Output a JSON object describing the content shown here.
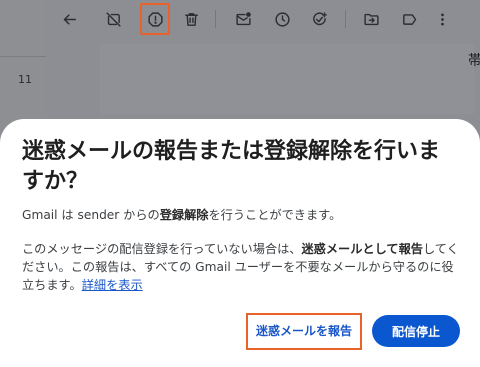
{
  "background": {
    "left_number": "11",
    "message_fragment": "帯"
  },
  "toolbar": {
    "icons": [
      "back-arrow-icon",
      "hide-icon",
      "report-spam-icon",
      "delete-icon",
      "mark-unread-icon",
      "snooze-icon",
      "add-task-icon",
      "move-to-icon",
      "label-icon",
      "more-icon"
    ],
    "highlighted": "report-spam-icon"
  },
  "dialog": {
    "title": "迷惑メールの報告または登録解除を行いますか？",
    "body1": {
      "prefix": "Gmail は sender からの",
      "strong": "登録解除",
      "suffix": "を行うことができます。"
    },
    "body2": {
      "prefix": "このメッセージの配信登録を行っていない場合は、",
      "strong": "迷惑メールとして報告",
      "middle": "してください。この報告は、すべての Gmail ユーザーを不要なメールから守るのに役立ちます。",
      "link": "詳細を表示"
    },
    "report_button_label": "迷惑メールを報告",
    "unsubscribe_button_label": "配信停止"
  },
  "colors": {
    "accent": "#0b57d0",
    "link": "#1a57c9",
    "highlight": "#e8622a"
  }
}
